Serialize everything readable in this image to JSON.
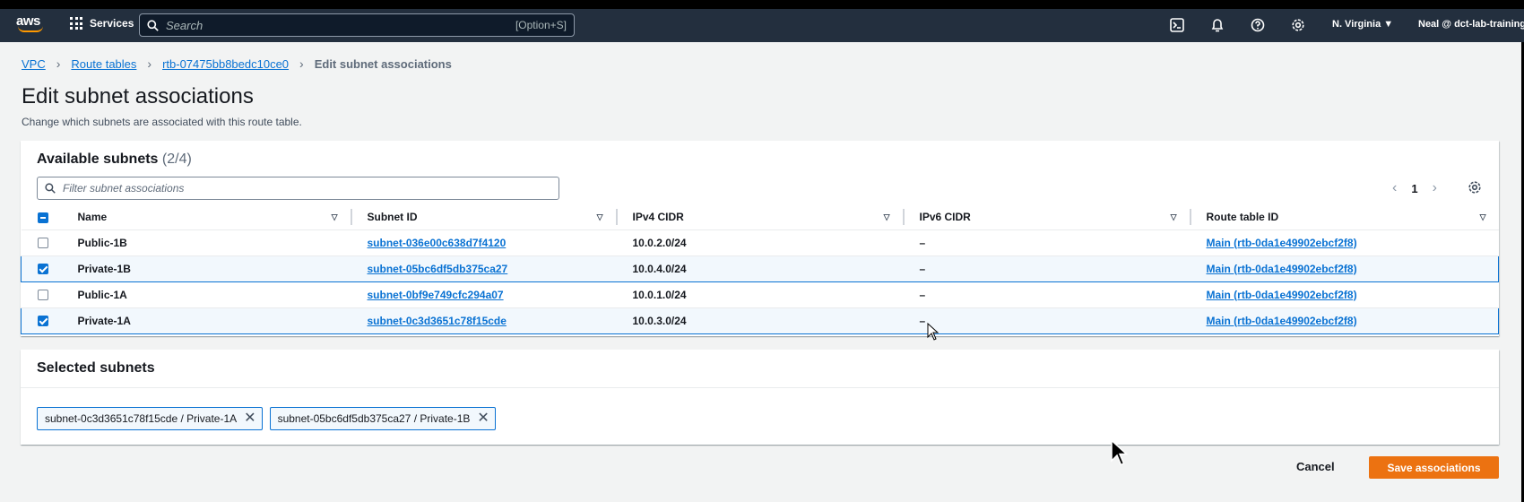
{
  "topbar": {
    "logo": "aws",
    "services_label": "Services",
    "search_placeholder": "Search",
    "search_shortcut": "[Option+S]",
    "region": "N. Virginia ▼",
    "user": "Neal @ dct-lab-training"
  },
  "breadcrumb": {
    "items": [
      "VPC",
      "Route tables",
      "rtb-07475bb8bedc10ce0"
    ],
    "current": "Edit subnet associations"
  },
  "page": {
    "title": "Edit subnet associations",
    "description": "Change which subnets are associated with this route table."
  },
  "available": {
    "title": "Available subnets",
    "count": "(2/4)",
    "filter_placeholder": "Filter subnet associations",
    "page_number": "1",
    "columns": [
      "Name",
      "Subnet ID",
      "IPv4 CIDR",
      "IPv6 CIDR",
      "Route table ID"
    ],
    "rows": [
      {
        "name": "Public-1B",
        "subnet_id": "subnet-036e00c638d7f4120",
        "ipv4": "10.0.2.0/24",
        "ipv6": "–",
        "route_table": "Main (rtb-0da1e49902ebcf2f8)",
        "checked": false
      },
      {
        "name": "Private-1B",
        "subnet_id": "subnet-05bc6df5db375ca27",
        "ipv4": "10.0.4.0/24",
        "ipv6": "–",
        "route_table": "Main (rtb-0da1e49902ebcf2f8)",
        "checked": true
      },
      {
        "name": "Public-1A",
        "subnet_id": "subnet-0bf9e749cfc294a07",
        "ipv4": "10.0.1.0/24",
        "ipv6": "–",
        "route_table": "Main (rtb-0da1e49902ebcf2f8)",
        "checked": false
      },
      {
        "name": "Private-1A",
        "subnet_id": "subnet-0c3d3651c78f15cde",
        "ipv4": "10.0.3.0/24",
        "ipv6": "–",
        "route_table": "Main (rtb-0da1e49902ebcf2f8)",
        "checked": true
      }
    ]
  },
  "selected": {
    "title": "Selected subnets",
    "tokens": [
      "subnet-0c3d3651c78f15cde / Private-1A",
      "subnet-05bc6df5db375ca27 / Private-1B"
    ]
  },
  "actions": {
    "cancel": "Cancel",
    "save": "Save associations"
  },
  "colors": {
    "topbar": "#232f3e",
    "link": "#0972d3",
    "primary_button": "#ec7211"
  }
}
